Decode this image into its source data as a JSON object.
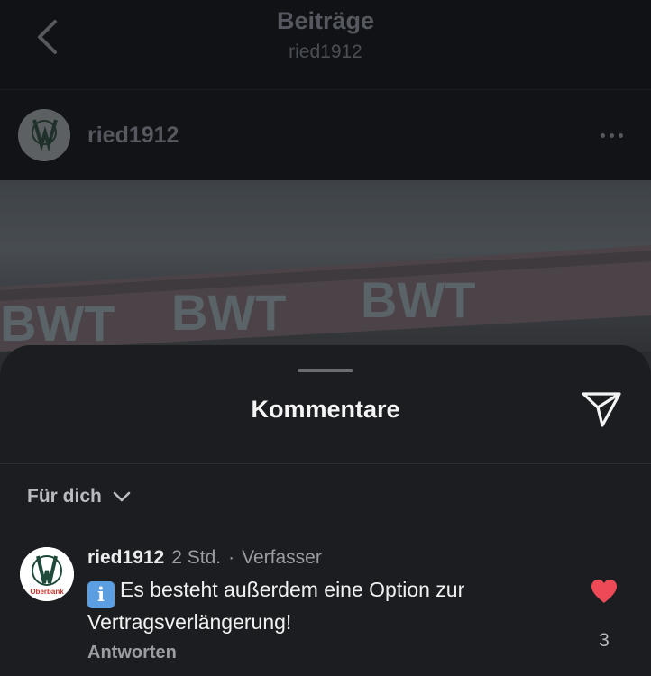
{
  "header": {
    "title": "Beiträge",
    "subtitle": "ried1912",
    "back_icon": "chevron-left-icon"
  },
  "post": {
    "username": "ried1912",
    "more_icon": "more-horizontal-icon",
    "photo_banner_text": "BWT"
  },
  "comments_sheet": {
    "title": "Kommentare",
    "share_icon": "send-icon",
    "filter_label": "Für dich",
    "filter_icon": "chevron-down-icon"
  },
  "comment": {
    "username": "ried1912",
    "time": "2 Std.",
    "separator": "·",
    "author_tag": "Verfasser",
    "info_emoji": "i",
    "text": "Es besteht außerdem eine Option zur Vertragsverlängerung!",
    "reply_label": "Antworten",
    "like_count": "3",
    "heart_color": "#ed4956"
  },
  "avatar_label": "Oberbank"
}
